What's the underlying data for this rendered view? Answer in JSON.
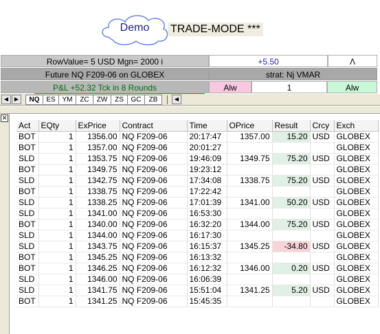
{
  "header": {
    "badge": "Demo",
    "mode": "TRADE-MODE ***"
  },
  "panel": {
    "row_value": "RowValue= 5 USD Mgn= 2000 i",
    "price_offset": "+5.50",
    "caret": "Λ",
    "future": "Future NQ  F209-06 on GLOBEX",
    "strategy": "strat: Nj VMAR",
    "pnl": "P&L +52.32 Tck in 8 Rounds",
    "allow_left": "Alw",
    "quantity": "1",
    "allow_right": "Alw"
  },
  "tabs": [
    "NQ",
    "ES",
    "YM",
    "ZC",
    "ZW",
    "ZS",
    "GC",
    "ZB"
  ],
  "colors": {
    "pnl_text": "#007000",
    "positive_result": "#e0f0e4",
    "negative_result": "#f8d4d8",
    "allow_left_bg": "#f8c8e0",
    "allow_right_bg": "#c8f8d8",
    "offset_text": "#2020c0"
  },
  "table": {
    "columns": [
      "Act",
      "EQty",
      "ExPrice",
      "Contract",
      "Time",
      "OPrice",
      "Result",
      "Crcy",
      "Exch"
    ],
    "rows": [
      [
        "BOT",
        "1",
        "1356.00",
        "NQ  F209-06",
        "20:17:47",
        "1357.00",
        "15.20",
        "USD",
        "GLOBEX"
      ],
      [
        "BOT",
        "1",
        "1357.00",
        "NQ  F209-06",
        "20:01:27",
        "",
        "",
        "",
        "GLOBEX"
      ],
      [
        "SLD",
        "1",
        "1353.75",
        "NQ  F209-06",
        "19:46:09",
        "1349.75",
        "75.20",
        "USD",
        "GLOBEX"
      ],
      [
        "BOT",
        "1",
        "1349.75",
        "NQ  F209-06",
        "19:23:12",
        "",
        "",
        "",
        "GLOBEX"
      ],
      [
        "SLD",
        "1",
        "1342.75",
        "NQ  F209-06",
        "17:34:08",
        "1338.75",
        "75.20",
        "USD",
        "GLOBEX"
      ],
      [
        "BOT",
        "1",
        "1338.75",
        "NQ  F209-06",
        "17:22:42",
        "",
        "",
        "",
        "GLOBEX"
      ],
      [
        "SLD",
        "1",
        "1338.25",
        "NQ  F209-06",
        "17:01:39",
        "1341.00",
        "50.20",
        "USD",
        "GLOBEX"
      ],
      [
        "SLD",
        "1",
        "1341.00",
        "NQ  F209-06",
        "16:53:30",
        "",
        "",
        "",
        "GLOBEX"
      ],
      [
        "BOT",
        "1",
        "1340.00",
        "NQ  F209-06",
        "16:32:20",
        "1344.00",
        "75.20",
        "USD",
        "GLOBEX"
      ],
      [
        "SLD",
        "1",
        "1344.00",
        "NQ  F209-06",
        "16:17:30",
        "",
        "",
        "",
        "GLOBEX"
      ],
      [
        "SLD",
        "1",
        "1343.75",
        "NQ  F209-06",
        "16:15:37",
        "1345.25",
        "-34.80",
        "USD",
        "GLOBEX"
      ],
      [
        "BOT",
        "1",
        "1345.25",
        "NQ  F209-06",
        "16:13:32",
        "",
        "",
        "",
        "GLOBEX"
      ],
      [
        "BOT",
        "1",
        "1346.25",
        "NQ  F209-06",
        "16:12:32",
        "1346.00",
        "0.20",
        "USD",
        "GLOBEX"
      ],
      [
        "SLD",
        "1",
        "1346.00",
        "NQ  F209-06",
        "16:06:39",
        "",
        "",
        "",
        "GLOBEX"
      ],
      [
        "SLD",
        "1",
        "1341.75",
        "NQ  F209-06",
        "15:51:04",
        "1341.25",
        "5.20",
        "USD",
        "GLOBEX"
      ],
      [
        "BOT",
        "1",
        "1341.25",
        "NQ  F209-06",
        "15:45:35",
        "",
        "",
        "",
        "GLOBEX"
      ]
    ]
  }
}
